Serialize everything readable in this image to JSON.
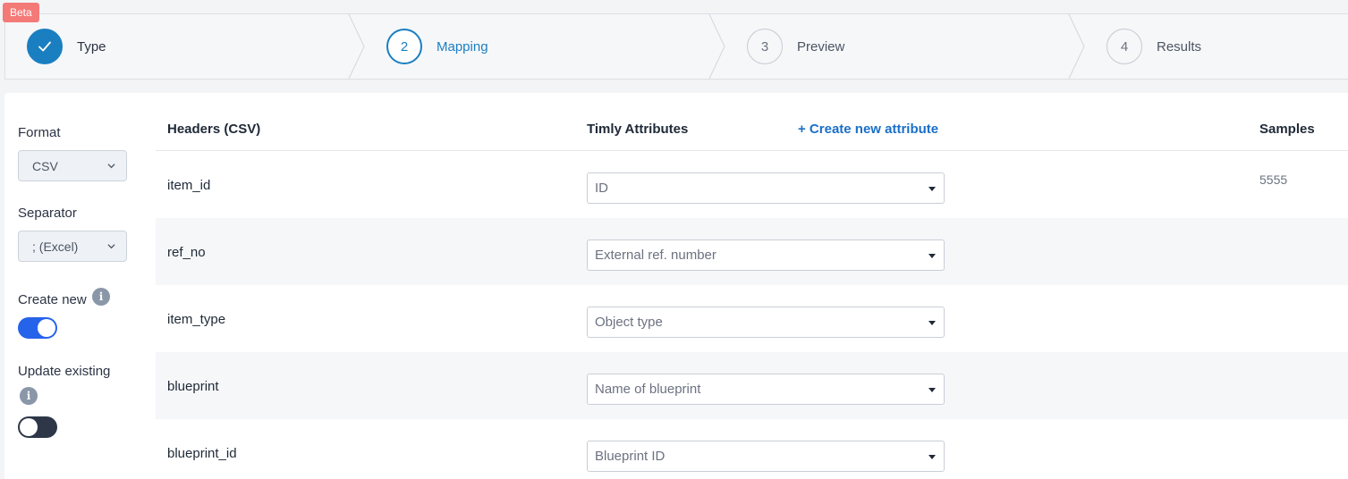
{
  "badge": "Beta",
  "stepper": [
    {
      "number": "",
      "label": "Type",
      "state": "done",
      "icon": "check-icon"
    },
    {
      "number": "2",
      "label": "Mapping",
      "state": "active"
    },
    {
      "number": "3",
      "label": "Preview",
      "state": "pending"
    },
    {
      "number": "4",
      "label": "Results",
      "state": "pending"
    }
  ],
  "settings": {
    "format_label": "Format",
    "format_value": "CSV",
    "separator_label": "Separator",
    "separator_value": "; (Excel)",
    "create_new_label": "Create new",
    "create_new_on": true,
    "update_existing_label": "Update existing",
    "update_existing_on": false,
    "info_glyph": "i"
  },
  "table": {
    "col_headers": "Headers (CSV)",
    "col_attributes": "Timly Attributes",
    "create_attribute": "+ Create new attribute",
    "col_samples": "Samples",
    "rows": [
      {
        "header": "item_id",
        "attribute": "ID",
        "sample": "5555"
      },
      {
        "header": "ref_no",
        "attribute": "External ref. number",
        "sample": ""
      },
      {
        "header": "item_type",
        "attribute": "Object type",
        "sample": ""
      },
      {
        "header": "blueprint",
        "attribute": "Name of blueprint",
        "sample": ""
      },
      {
        "header": "blueprint_id",
        "attribute": "Blueprint ID",
        "sample": ""
      }
    ]
  },
  "colors": {
    "accent": "#1a7fc1",
    "link": "#1a6fc9",
    "toggle_on": "#2563eb",
    "toggle_off": "#2d3748",
    "badge": "#f47a78"
  }
}
